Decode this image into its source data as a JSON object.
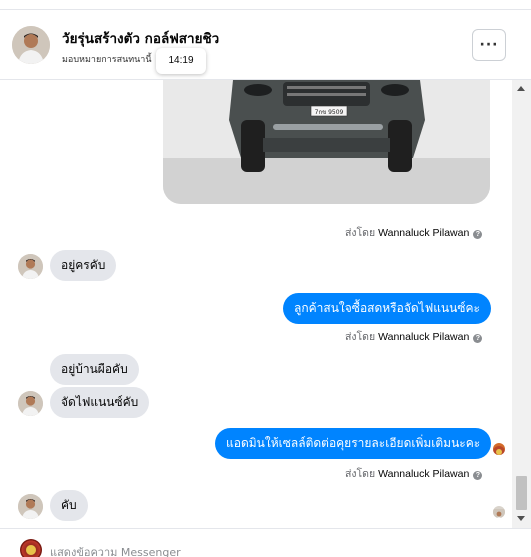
{
  "header": {
    "name": "วัยรุ่นสร้างตัว กอล์ฟสายชิว",
    "subtitle": "มอบหมายการสนทนานี้",
    "tooltip_time": "14:19",
    "more_label": "···"
  },
  "thread": {
    "sent_by_prefix": "ส่งโดย",
    "agent_name": "Wannaluck Pilawan",
    "help_glyph": "?",
    "image_plate": "7กข 9509",
    "messages": [
      {
        "from": "customer",
        "text": "อยู่ครคับ"
      },
      {
        "from": "page",
        "text": "ลูกค้าสนใจซื้อสดหรือจัดไฟแนนซ์คะ"
      },
      {
        "from": "customer",
        "text": "อยู่บ้านผือคับ"
      },
      {
        "from": "customer",
        "text": "จัดไฟแนนซ์คับ"
      },
      {
        "from": "page",
        "text": "แอดมินให้เซลล์ติดต่อคุยรายละเอียดเพิ่มเติมนะคะ"
      },
      {
        "from": "customer",
        "text": "คับ"
      }
    ]
  },
  "composer": {
    "placeholder": "แสดงข้อความ Messenger"
  },
  "colors": {
    "outgoing_bubble": "#0084ff",
    "incoming_bubble": "#e4e6eb"
  },
  "icons": [
    "avatar",
    "more-icon",
    "help-icon",
    "seen-avatar-icon",
    "scroll-up-icon",
    "scroll-down-icon"
  ]
}
